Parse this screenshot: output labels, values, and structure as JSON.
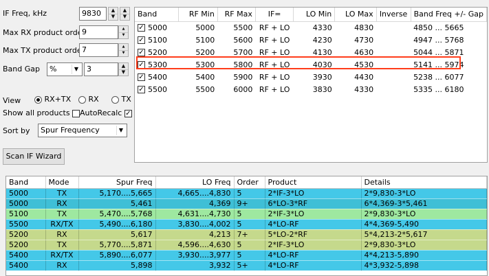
{
  "controls": {
    "if_freq_label": "IF Freq, kHz",
    "if_freq_value": "9830",
    "max_rx_label": "Max RX product order",
    "max_rx_value": "9",
    "max_tx_label": "Max TX product order",
    "max_tx_value": "7",
    "band_gap_label": "Band Gap",
    "band_gap_unit": "%",
    "band_gap_value": "3",
    "view_label": "View",
    "view_options": [
      "RX+TX",
      "RX",
      "TX"
    ],
    "view_selected": "RX+TX",
    "show_all_label": "Show all products",
    "show_all_checked": false,
    "autorecalc_label": "AutoRecalc",
    "autorecalc_checked": true,
    "sort_label": "Sort by",
    "sort_value": "Spur Frequency",
    "scan_button": "Scan IF Wizard"
  },
  "bands_table": {
    "headers": [
      "Band",
      "RF Min",
      "RF Max",
      "IF=",
      "LO Min",
      "LO Max",
      "Inverse",
      "Band Freq +/- Gap"
    ],
    "selected_band": "5300",
    "rows": [
      {
        "checked": true,
        "band": "5000",
        "rf_min": "5000",
        "rf_max": "5500",
        "if": "RF + LO",
        "lo_min": "4330",
        "lo_max": "4830",
        "inverse": "",
        "band_freq": "4850 ... 5665"
      },
      {
        "checked": true,
        "band": "5100",
        "rf_min": "5100",
        "rf_max": "5600",
        "if": "RF + LO",
        "lo_min": "4230",
        "lo_max": "4730",
        "inverse": "",
        "band_freq": "4947 ... 5768"
      },
      {
        "checked": true,
        "band": "5200",
        "rf_min": "5200",
        "rf_max": "5700",
        "if": "RF + LO",
        "lo_min": "4130",
        "lo_max": "4630",
        "inverse": "",
        "band_freq": "5044 ... 5871"
      },
      {
        "checked": true,
        "band": "5300",
        "rf_min": "5300",
        "rf_max": "5800",
        "if": "RF + LO",
        "lo_min": "4030",
        "lo_max": "4530",
        "inverse": "",
        "band_freq": "5141 ... 5974"
      },
      {
        "checked": true,
        "band": "5400",
        "rf_min": "5400",
        "rf_max": "5900",
        "if": "RF + LO",
        "lo_min": "3930",
        "lo_max": "4430",
        "inverse": "",
        "band_freq": "5238 ... 6077"
      },
      {
        "checked": true,
        "band": "5500",
        "rf_min": "5500",
        "rf_max": "6000",
        "if": "RF + LO",
        "lo_min": "3830",
        "lo_max": "4330",
        "inverse": "",
        "band_freq": "5335 ... 6180"
      }
    ]
  },
  "spur_table": {
    "headers": [
      "Band",
      "Mode",
      "Spur Freq",
      "LO Freq",
      "Order",
      "Product",
      "Details"
    ],
    "colors": {
      "tx": "#45c9e6",
      "rx": "#8fe68f",
      "rxtx": "#45c9e6",
      "mix": "#45c9e6"
    },
    "rows": [
      {
        "band": "5000",
        "mode": "TX",
        "spur": "5,170....5,665",
        "lo": "4,665....4,830",
        "order": "5",
        "product": "2*IF-3*LO",
        "details": "2*9,830-3*LO",
        "color": "#44c8e8"
      },
      {
        "band": "5000",
        "mode": "RX",
        "spur": "5,461",
        "lo": "4,369",
        "order": "9+",
        "product": "6*LO-3*RF",
        "details": "6*4,369-3*5,461",
        "color": "#3fbfd6"
      },
      {
        "band": "5100",
        "mode": "TX",
        "spur": "5,470....5,768",
        "lo": "4,631....4,730",
        "order": "5",
        "product": "2*IF-3*LO",
        "details": "2*9,830-3*LO",
        "color": "#9ee8a0"
      },
      {
        "band": "5500",
        "mode": "RX/TX",
        "spur": "5,490....6,180",
        "lo": "3,830....4,002",
        "order": "5",
        "product": "4*LO-RF",
        "details": "4*4,369-5,490",
        "color": "#44c8e8"
      },
      {
        "band": "5200",
        "mode": "RX",
        "spur": "5,617",
        "lo": "4,213",
        "order": "7+",
        "product": "5*LO-2*RF",
        "details": "5*4,213-2*5,617",
        "color": "#c5d98c"
      },
      {
        "band": "5200",
        "mode": "TX",
        "spur": "5,770....5,871",
        "lo": "4,596....4,630",
        "order": "5",
        "product": "2*IF-3*LO",
        "details": "2*9,830-3*LO",
        "color": "#c5d98c"
      },
      {
        "band": "5400",
        "mode": "RX/TX",
        "spur": "5,890....6,077",
        "lo": "3,930....3,977",
        "order": "5",
        "product": "4*LO-RF",
        "details": "4*4,213-5,890",
        "color": "#44c8e8"
      },
      {
        "band": "5400",
        "mode": "RX",
        "spur": "5,898",
        "lo": "3,932",
        "order": "5+",
        "product": "4*LO-RF",
        "details": "4*3,932-5,898",
        "color": "#44c8e8"
      }
    ]
  }
}
